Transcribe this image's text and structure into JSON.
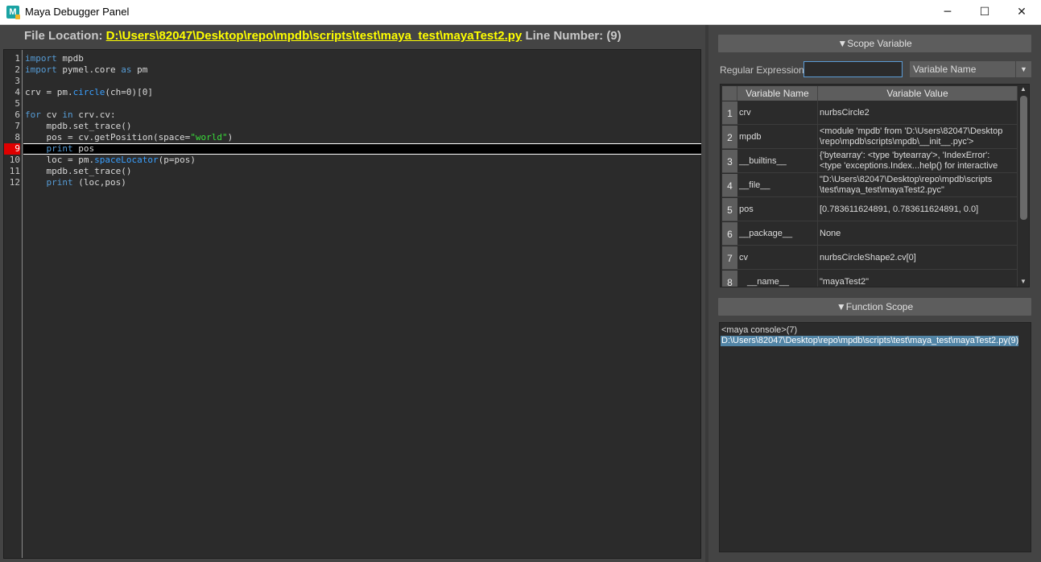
{
  "window": {
    "icon_letter": "M",
    "title": "Maya Debugger Panel",
    "minimize_glyph": "─",
    "maximize_glyph": "☐",
    "close_glyph": "✕"
  },
  "editor": {
    "file_location_label": "File Location:",
    "file_path": "D:\\Users\\82047\\Desktop\\repo\\mpdb\\scripts\\test\\maya_test\\mayaTest2.py",
    "line_number_label": "Line Number:",
    "line_number_value": "(9)",
    "current_line": 9,
    "lines": [
      "1",
      "2",
      "3",
      "4",
      "5",
      "6",
      "7",
      "8",
      "9",
      "10",
      "11",
      "12"
    ]
  },
  "scope_variable": {
    "header": "▼Scope Variable",
    "filter_label": "Regular Expression",
    "filter_value": "",
    "combo_value": "Variable Name",
    "columns": [
      "Variable Name",
      "Variable Value"
    ],
    "rows": [
      {
        "index": "1",
        "name": "crv",
        "value": "nurbsCircle2",
        "value2": ""
      },
      {
        "index": "2",
        "name": "mpdb",
        "value": "<module 'mpdb' from 'D:\\Users\\82047\\Desktop",
        "value2": "\\repo\\mpdb\\scripts\\mpdb\\__init__.pyc'>"
      },
      {
        "index": "3",
        "name": "__builtins__",
        "value": "{'bytearray': <type 'bytearray'>, 'IndexError':",
        "value2": "<type 'exceptions.Index...help() for interactive"
      },
      {
        "index": "4",
        "name": "__file__",
        "value": "\"D:\\Users\\82047\\Desktop\\repo\\mpdb\\scripts",
        "value2": "\\test\\maya_test\\mayaTest2.pyc\""
      },
      {
        "index": "5",
        "name": "pos",
        "value": "[0.783611624891, 0.783611624891, 0.0]",
        "value2": ""
      },
      {
        "index": "6",
        "name": "__package__",
        "value": "None",
        "value2": ""
      },
      {
        "index": "7",
        "name": "cv",
        "value": "nurbsCircleShape2.cv[0]",
        "value2": ""
      },
      {
        "index": "8",
        "name": "__name__",
        "value": "\"mayaTest2\"",
        "value2": ""
      }
    ]
  },
  "function_scope": {
    "header": "▼Function Scope",
    "items": [
      {
        "label": "<maya console>(7)",
        "selected": false
      },
      {
        "label": "D:\\Users\\82047\\Desktop\\repo\\mpdb\\scripts\\test\\maya_test\\mayaTest2.py(9)",
        "selected": true
      }
    ]
  }
}
